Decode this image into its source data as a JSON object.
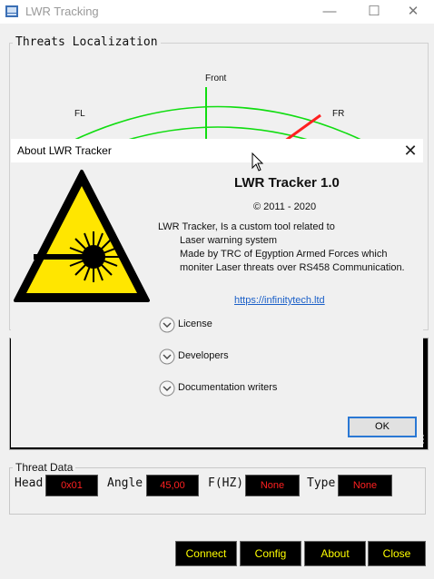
{
  "window": {
    "title": "LWR Tracking",
    "minimize": "—",
    "maximize": "☐",
    "close": "✕"
  },
  "localization": {
    "title": "Threats Localization",
    "labels": {
      "front": "Front",
      "fl": "FL",
      "fr": "FR"
    }
  },
  "threat_data": {
    "title": "Threat Data",
    "fields": [
      {
        "label": "Head",
        "value": "0x01"
      },
      {
        "label": "Angle",
        "value": "45,00"
      },
      {
        "label": "F(HZ)",
        "value": "None"
      },
      {
        "label": "Type",
        "value": "None"
      }
    ]
  },
  "buttons": {
    "connect": "Connect",
    "config": "Config",
    "about": "About",
    "close": "Close"
  },
  "about_dialog": {
    "title": "About LWR Tracker",
    "close": "✕",
    "app_name": "LWR Tracker 1.0",
    "copyright": "© 2011 - 2020",
    "description": [
      "LWR Tracker, Is a custom tool related to",
      "Laser warning system",
      "Made by TRC of Egyption Armed Forces which",
      "moniter Laser threats over RS458 Communication."
    ],
    "link": "https://infinitytech.ltd",
    "expanders": [
      "License",
      "Developers",
      "Documentation writers"
    ],
    "ok": "OK"
  },
  "colors": {
    "accent_green": "#11dd11",
    "threat_red": "#ff2020",
    "button_text": "#ffff00"
  }
}
